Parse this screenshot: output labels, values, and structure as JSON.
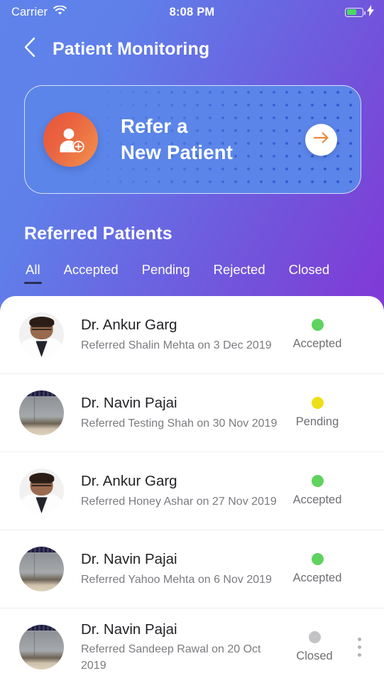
{
  "status_bar": {
    "carrier": "Carrier",
    "wifi_icon": "wifi-icon",
    "time": "8:08 PM",
    "battery_icon": "battery-icon",
    "charging_icon": "lightning-bolt-icon"
  },
  "header": {
    "back_icon": "chevron-left-icon",
    "title": "Patient Monitoring"
  },
  "refer_card": {
    "avatar_icon": "add-user-icon",
    "line1": "Refer a",
    "line2": "New Patient",
    "go_icon": "arrow-right-icon",
    "card_color": "#5b85e8",
    "dot_color": "#2f59cf",
    "avatar_gradient_from": "#e8563c",
    "avatar_gradient_to": "#f2924d",
    "arrow_color": "#e8883f"
  },
  "section": {
    "title": "Referred Patients"
  },
  "tabs": [
    {
      "label": "All",
      "active": true
    },
    {
      "label": "Accepted",
      "active": false
    },
    {
      "label": "Pending",
      "active": false
    },
    {
      "label": "Rejected",
      "active": false
    },
    {
      "label": "Closed",
      "active": false
    }
  ],
  "status_colors": {
    "accepted": "#5ed35e",
    "pending": "#ede018",
    "closed": "#c3c3c6"
  },
  "patients": [
    {
      "doctor": "Dr. Ankur Garg",
      "referral": "Referred Shalin Mehta on 3 Dec 2019",
      "status": "Accepted",
      "status_color": "#5ed35e",
      "avatar_type": "doctor",
      "has_menu": false
    },
    {
      "doctor": "Dr. Navin Pajai",
      "referral": "Referred Testing Shah on 30 Nov 2019",
      "status": "Pending",
      "status_color": "#ede018",
      "avatar_type": "room",
      "has_menu": false
    },
    {
      "doctor": "Dr. Ankur Garg",
      "referral": "Referred Honey Ashar on 27 Nov 2019",
      "status": "Accepted",
      "status_color": "#5ed35e",
      "avatar_type": "doctor",
      "has_menu": false
    },
    {
      "doctor": "Dr. Navin Pajai",
      "referral": "Referred Yahoo Mehta on 6 Nov 2019",
      "status": "Accepted",
      "status_color": "#5ed35e",
      "avatar_type": "room",
      "has_menu": false
    },
    {
      "doctor": "Dr. Navin Pajai",
      "referral": "Referred Sandeep Rawal on 20 Oct 2019",
      "status": "Closed",
      "status_color": "#c3c3c6",
      "avatar_type": "room",
      "has_menu": true
    }
  ]
}
